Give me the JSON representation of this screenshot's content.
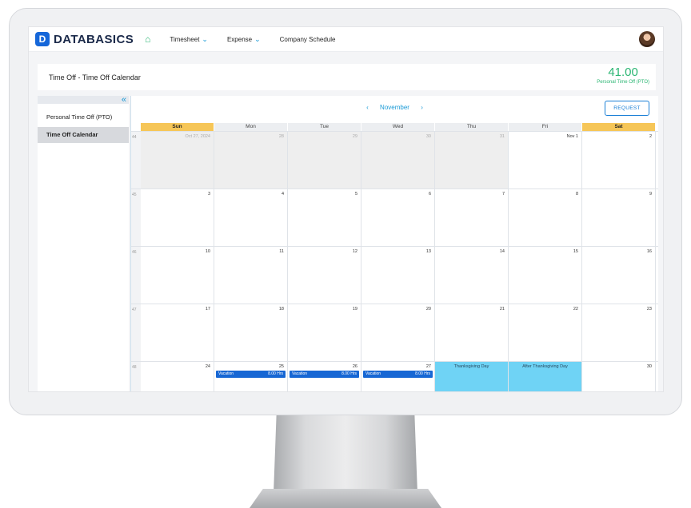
{
  "brand": {
    "logo_mark": "D",
    "name": "DATABASICS"
  },
  "nav": {
    "home_icon": "home-icon",
    "items": [
      {
        "label": "Timesheet",
        "has_dropdown": true
      },
      {
        "label": "Expense",
        "has_dropdown": true
      },
      {
        "label": "Company Schedule",
        "has_dropdown": false
      }
    ]
  },
  "header": {
    "title": "Time Off - Time Off Calendar",
    "balance_value": "41.00",
    "balance_label": "Personal Time Off (PTO)"
  },
  "sidebar": {
    "collapse_icon": "«",
    "items": [
      {
        "label": "Personal Time Off (PTO)",
        "active": false
      },
      {
        "label": "Time Off Calendar",
        "active": true
      }
    ]
  },
  "calendar": {
    "month": "November",
    "prev_glyph": "‹",
    "next_glyph": "›",
    "request_label": "REQUEST",
    "weekdays": [
      "Sun",
      "Mon",
      "Tue",
      "Wed",
      "Thu",
      "Fri",
      "Sat"
    ],
    "weeks": [
      {
        "num": "44",
        "days": [
          {
            "label": "Oct 27, 2024",
            "other": true
          },
          {
            "label": "28",
            "other": true
          },
          {
            "label": "29",
            "other": true
          },
          {
            "label": "30",
            "other": true
          },
          {
            "label": "31",
            "other": true
          },
          {
            "label": "Nov 1"
          },
          {
            "label": "2"
          }
        ]
      },
      {
        "num": "45",
        "days": [
          {
            "label": "3"
          },
          {
            "label": "4"
          },
          {
            "label": "5"
          },
          {
            "label": "6"
          },
          {
            "label": "7"
          },
          {
            "label": "8"
          },
          {
            "label": "9"
          }
        ]
      },
      {
        "num": "46",
        "days": [
          {
            "label": "10"
          },
          {
            "label": "11"
          },
          {
            "label": "12"
          },
          {
            "label": "13"
          },
          {
            "label": "14"
          },
          {
            "label": "15"
          },
          {
            "label": "16"
          }
        ]
      },
      {
        "num": "47",
        "days": [
          {
            "label": "17"
          },
          {
            "label": "18"
          },
          {
            "label": "19"
          },
          {
            "label": "20"
          },
          {
            "label": "21"
          },
          {
            "label": "22"
          },
          {
            "label": "23"
          }
        ]
      },
      {
        "num": "48",
        "days": [
          {
            "label": "24"
          },
          {
            "label": "25",
            "event": {
              "type": "Vacation",
              "hours": "8.00 Hrs"
            }
          },
          {
            "label": "26",
            "event": {
              "type": "Vacation",
              "hours": "8.00 Hrs"
            }
          },
          {
            "label": "27",
            "event": {
              "type": "Vacation",
              "hours": "8.00 Hrs"
            }
          },
          {
            "holiday": "Thanksgiving Day"
          },
          {
            "holiday": "After Thanksgiving Day"
          },
          {
            "label": "30"
          }
        ]
      }
    ]
  },
  "colors": {
    "accent_blue": "#1a9ad6",
    "event_blue": "#1767d4",
    "holiday_cyan": "#6fd3f5",
    "weekend_header": "#f6c658",
    "pto_green": "#2bb673"
  }
}
